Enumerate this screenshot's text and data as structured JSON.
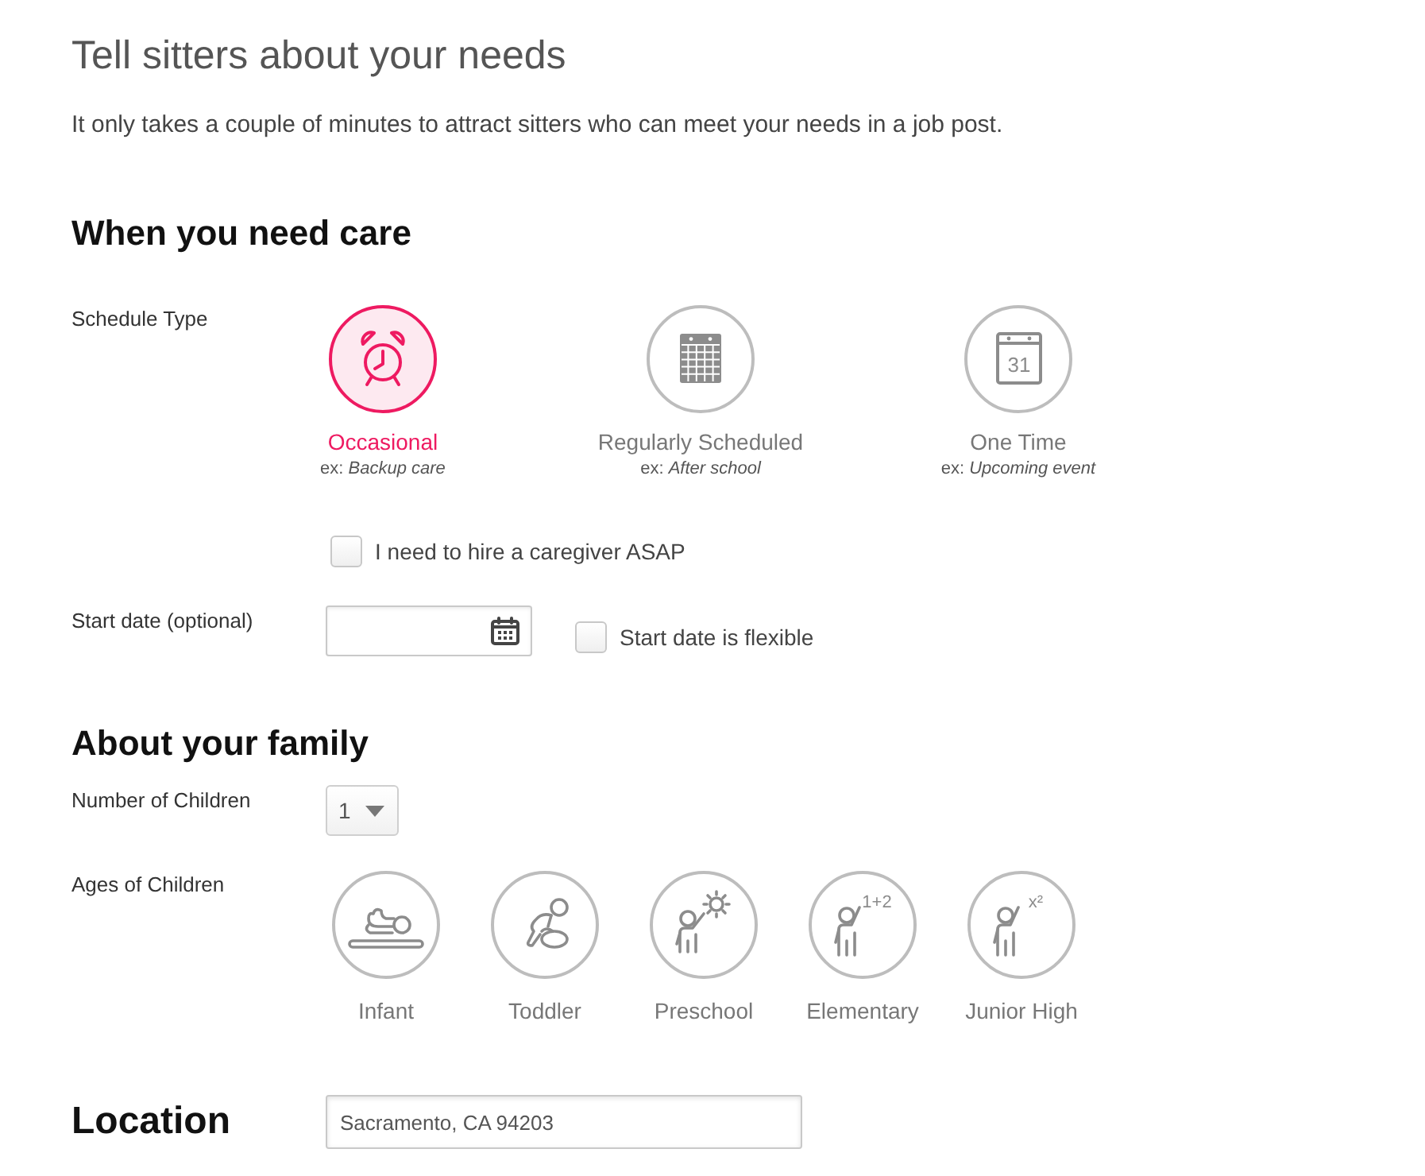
{
  "title": "Tell sitters about your needs",
  "intro": "It only takes a couple of minutes to attract sitters who can meet your needs in a job post.",
  "care": {
    "heading": "When you need care",
    "schedule_label": "Schedule Type",
    "schedule_options": [
      {
        "kind": "clock",
        "label": "Occasional",
        "example": "ex: *Backup care*",
        "selected": true
      },
      {
        "kind": "grid_calendar",
        "label": "Regularly Scheduled",
        "example": "ex: *After school*",
        "selected": false
      },
      {
        "kind": "date_calendar",
        "label": "One Time",
        "example": "ex: *Upcoming event*",
        "icon_text": "31",
        "selected": false
      }
    ],
    "asap": {
      "label": "I need to hire a caregiver ASAP",
      "checked": false
    },
    "start_date": {
      "label": "Start date (optional)",
      "flexible": {
        "label": "Start date is flexible",
        "checked": false
      }
    }
  },
  "family": {
    "heading": "About your family",
    "children_count": {
      "label": "Number of Children",
      "value": "1"
    },
    "ages": {
      "label": "Ages of Children",
      "options": [
        {
          "kind": "infant",
          "label": "Infant",
          "selected": false
        },
        {
          "kind": "toddler",
          "label": "Toddler",
          "selected": false
        },
        {
          "kind": "preschool",
          "label": "Preschool",
          "selected": false
        },
        {
          "kind": "elementary",
          "label": "Elementary",
          "icon_text": "1+2",
          "selected": false
        },
        {
          "kind": "junior_high",
          "label": "Junior High",
          "icon_text": "x²",
          "selected": false
        }
      ]
    }
  },
  "location": {
    "heading": "Location",
    "value": "Sacramento, CA 94203"
  }
}
